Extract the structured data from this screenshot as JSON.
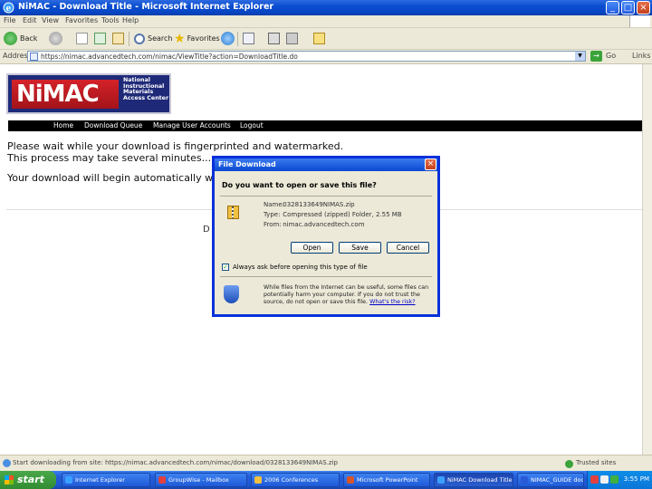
{
  "window": {
    "title": "NiMAC - Download Title - Microsoft Internet Explorer",
    "controls": [
      "_",
      "□",
      "×"
    ]
  },
  "menu": [
    "File",
    "Edit",
    "View",
    "Favorites",
    "Tools",
    "Help"
  ],
  "toolbar": {
    "back": "Back",
    "search": "Search",
    "favorites": "Favorites"
  },
  "address": {
    "label": "Address",
    "url": "https://nimac.advancedtech.com/nimac/ViewTitle?action=DownloadTitle.do",
    "go": "Go",
    "links": "Links"
  },
  "logo": {
    "text": "NiMAC",
    "subtitle": "National Instructional Materials Access Center"
  },
  "nav": [
    "Home",
    "Download Queue",
    "Manage User Accounts",
    "Logout"
  ],
  "messages": {
    "line1": "Please wait while your download is fingerprinted and watermarked.",
    "line2": "This process may take several minutes...",
    "line3": "Your download will begin automatically whe",
    "behind": "D"
  },
  "dialog": {
    "title": "File Download",
    "question": "Do you want to open or save this file?",
    "name_label": "Name:",
    "name_value": "0328133649NIMAS.zip",
    "type_label": "Type:",
    "type_value": "Compressed (zipped) Folder, 2.55 MB",
    "from_label": "From:",
    "from_value": "nimac.advancedtech.com",
    "buttons": {
      "open": "Open",
      "save": "Save",
      "cancel": "Cancel"
    },
    "checkbox_label": "Always ask before opening this type of file",
    "warning": "While files from the Internet can be useful, some files can potentially harm your computer. If you do not trust the source, do not open or save this file.",
    "risk_link": "What's the risk?"
  },
  "status": {
    "text": "Start downloading from site: https://nimac.advancedtech.com/nimac/download/0328133649NIMAS.zip",
    "zone": "Trusted sites"
  },
  "taskbar": {
    "start": "start",
    "tasks": [
      "Internet Explorer",
      "GroupWise - Mailbox",
      "2006 Conferences",
      "Microsoft PowerPoint",
      "NiMAC Download Title",
      "NIMAC_GUIDE doc"
    ],
    "clock": "3:55 PM"
  },
  "colors": {
    "titlebar": "#0a4ed0",
    "logo_red": "#c41a22",
    "logo_navy": "#1e2a78",
    "taskbar": "#245edb",
    "start": "#3c9a3d"
  }
}
